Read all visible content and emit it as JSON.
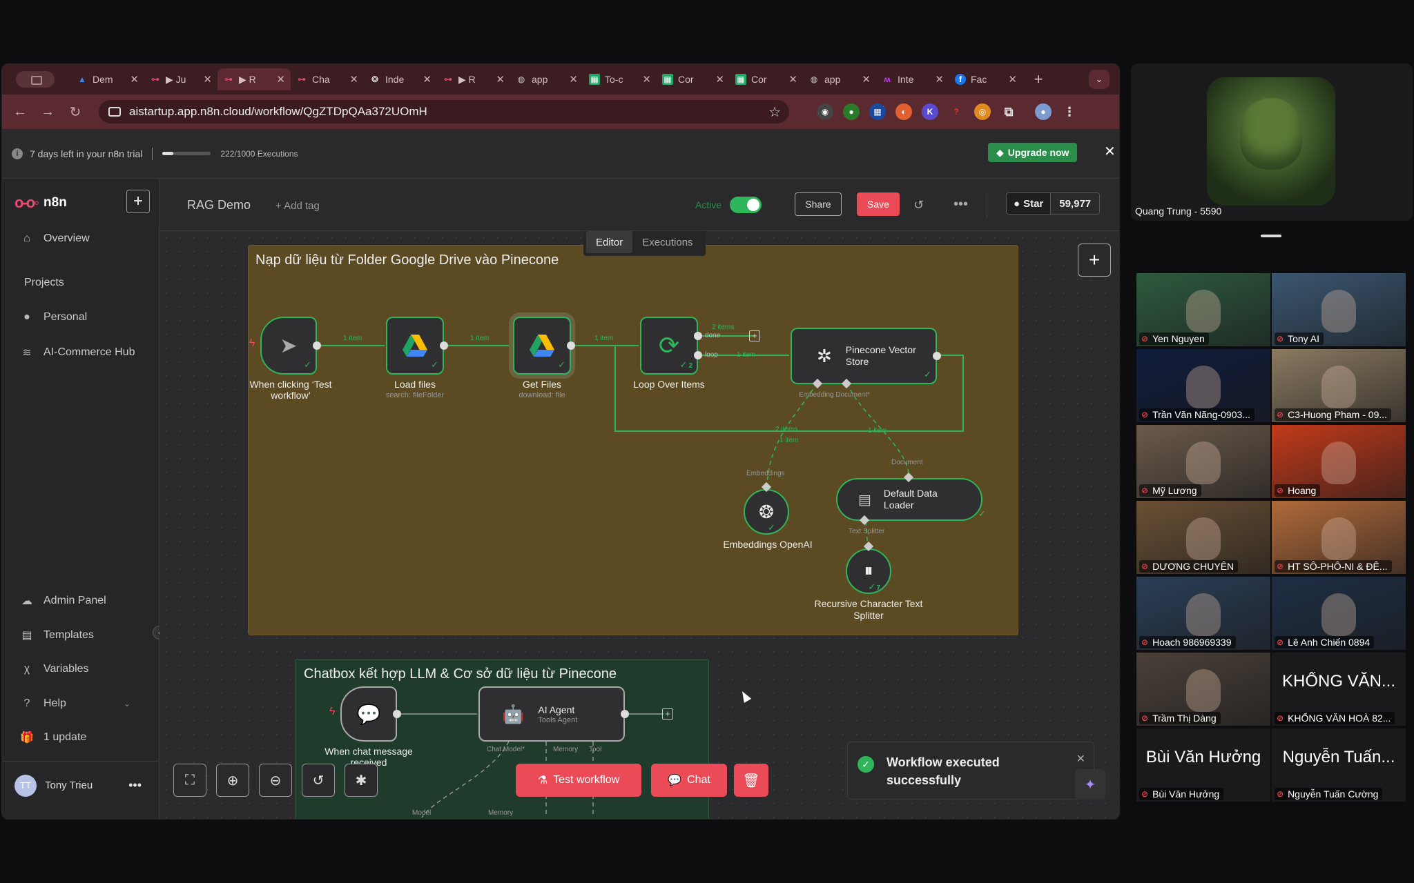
{
  "browser": {
    "tabs": [
      {
        "label": "Dem",
        "icon": "google-drive-icon",
        "color": "#4285f4"
      },
      {
        "label": "▶ Ju",
        "icon": "n8n-icon",
        "color": "#ea4b71"
      },
      {
        "label": "▶ R",
        "icon": "n8n-icon",
        "color": "#ea4b71",
        "active": true
      },
      {
        "label": "Cha",
        "icon": "n8n-icon",
        "color": "#ea4b71"
      },
      {
        "label": "Inde",
        "icon": "openai-icon",
        "color": "#ffffff"
      },
      {
        "label": "▶ R",
        "icon": "n8n-icon",
        "color": "#ea4b71"
      },
      {
        "label": "app",
        "icon": "globe-icon",
        "color": "#cccccc"
      },
      {
        "label": "To-c",
        "icon": "sheets-icon",
        "color": "#23a566"
      },
      {
        "label": "Cor",
        "icon": "sheets-icon",
        "color": "#23a566"
      },
      {
        "label": "Cor",
        "icon": "sheets-icon",
        "color": "#23a566"
      },
      {
        "label": "app",
        "icon": "globe-icon",
        "color": "#cccccc"
      },
      {
        "label": "Inte",
        "icon": "make-icon",
        "color": "#c23cf0"
      },
      {
        "label": "Fac",
        "icon": "facebook-icon",
        "color": "#1877f2"
      }
    ],
    "url": "aistartup.app.n8n.cloud/workflow/QgZTDpQAa372UOmH"
  },
  "trial": {
    "text": "7 days left in your n8n trial",
    "executions": "222/1000 Executions",
    "progress_fraction": 0.222,
    "upgrade_label": "Upgrade now"
  },
  "sidebar": {
    "brand": "n8n",
    "overview": "Overview",
    "projects_heading": "Projects",
    "personal": "Personal",
    "hub": "AI-Commerce Hub",
    "admin": "Admin Panel",
    "templates": "Templates",
    "variables": "Variables",
    "help": "Help",
    "update": "1 update",
    "user_initials": "TT",
    "user_name": "Tony Trieu"
  },
  "header": {
    "workflow_name": "RAG Demo",
    "add_tag": "+ Add tag",
    "active_label": "Active",
    "share": "Share",
    "save": "Save",
    "star_label": "Star",
    "star_count": "59,977"
  },
  "canvas": {
    "tabs": {
      "editor": "Editor",
      "executions": "Executions"
    },
    "sticky1_title": "Nạp dữ liệu từ Folder Google Drive vào Pinecone",
    "sticky2_title": "Chatbox kết hợp LLM & Cơ sở dữ liệu từ Pinecone",
    "nodes": {
      "trigger": {
        "label": "When clicking ‘Test workflow’"
      },
      "load": {
        "label": "Load files",
        "sub": "search: fileFolder"
      },
      "get": {
        "label": "Get Files",
        "sub": "download: file"
      },
      "loop": {
        "label": "Loop Over Items",
        "count": "2"
      },
      "pinecone": {
        "label": "Pinecone Vector Store"
      },
      "embeddings": {
        "label": "Embeddings OpenAI"
      },
      "loader": {
        "label": "Default Data Loader"
      },
      "splitter": {
        "label": "Recursive Character Text Splitter",
        "count": "7"
      },
      "chat_trigger": {
        "label": "When chat message received"
      },
      "agent": {
        "label": "AI Agent",
        "sub": "Tools Agent"
      }
    },
    "edges": {
      "e1": "1 item",
      "e2": "1 item",
      "e3": "1 item",
      "done_count": "2 items",
      "done": "done",
      "loop": "loop",
      "loop_count": "1 item",
      "back1": "2 items",
      "back2": "1 item",
      "back3": "1 item"
    },
    "subs": {
      "embedding_doc": "Embedding   Document*",
      "document": "Document",
      "embeddings": "Embeddings",
      "text_splitter": "Text Splitter",
      "chat_model": "Chat Model*",
      "memory": "Memory",
      "tool": "Tool",
      "model": "Model",
      "memory2": "Memory"
    },
    "buttons": {
      "test_workflow": "Test workflow",
      "chat": "Chat"
    },
    "toast": "Workflow executed successfully"
  },
  "meeting": {
    "speaker": "Quang Trung - 5590",
    "participants": [
      {
        "name": "Yen Nguyen",
        "bg": "#2d5a3e"
      },
      {
        "name": "Tony AI",
        "bg": "#3a5670"
      },
      {
        "name": "Trần Văn Năng-0903...",
        "bg": "#101c3c"
      },
      {
        "name": "C3-Huong Pham - 09...",
        "bg": "#8a7a60"
      },
      {
        "name": "Mỹ Lương",
        "bg": "#6a5a4a"
      },
      {
        "name": "Hoang",
        "bg": "#c23a1a"
      },
      {
        "name": "DƯƠNG CHUYÊN",
        "bg": "#6a5034"
      },
      {
        "name": "HT SÔ-PHÔ-NI & ĐÊ...",
        "bg": "#b06a3a"
      },
      {
        "name": "Hoach 986969339",
        "bg": "#2a3e56"
      },
      {
        "name": "Lê Anh Chiến 0894",
        "bg": "#1e2e44"
      },
      {
        "name": "Trầm Thị Dàng",
        "bg": "#4a4038"
      },
      {
        "name": "KHỔNG VĂN HOÀ 82...",
        "bg": "#1a1a1c",
        "big": "KHỔNG VĂN..."
      },
      {
        "name": "Bùi Văn Hưởng",
        "bg": "#1a1a1c",
        "big": "Bùi Văn Hưởng"
      },
      {
        "name": "Nguyễn Tuấn Cường",
        "bg": "#1a1a1c",
        "big": "Nguyễn Tuấn..."
      }
    ]
  }
}
